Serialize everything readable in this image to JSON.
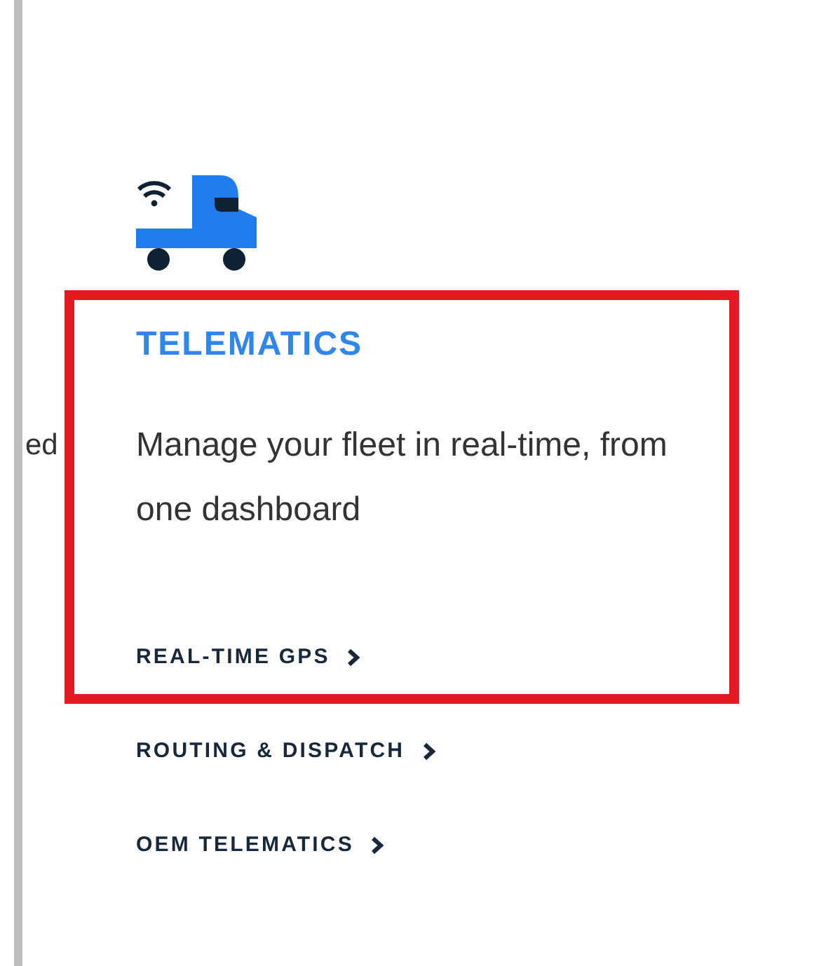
{
  "cut_text": "ed",
  "card": {
    "title": "TELEMATICS",
    "description": "Manage your fleet in real-time, from one dashboard",
    "links": [
      {
        "label": "REAL-TIME GPS"
      },
      {
        "label": "ROUTING & DISPATCH"
      },
      {
        "label": "OEM TELEMATICS"
      }
    ]
  }
}
